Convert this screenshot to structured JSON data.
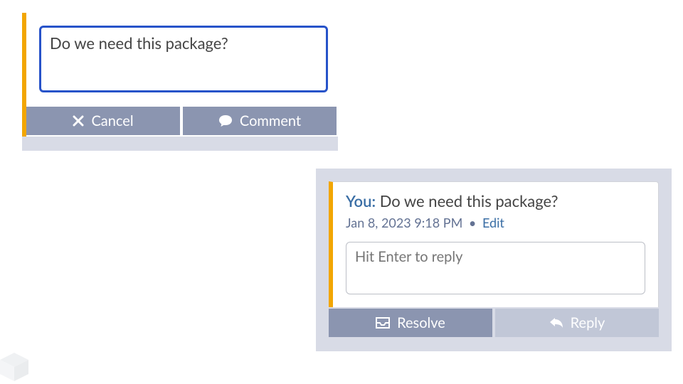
{
  "compose": {
    "text": "Do we need this package?",
    "cancel_label": "Cancel",
    "comment_label": "Comment"
  },
  "thread": {
    "author_label": "You:",
    "comment_text": "Do we need this package?",
    "timestamp": "Jan 8, 2023 9:18 PM",
    "meta_separator": "•",
    "edit_label": "Edit",
    "reply_placeholder": "Hit Enter to reply",
    "resolve_label": "Resolve",
    "reply_label": "Reply"
  },
  "colors": {
    "accent_bar": "#f2a600",
    "button_bg": "#8b95b0",
    "button_muted": "#c1c7d7",
    "focus_border": "#2753c9",
    "author": "#3a6ea5"
  }
}
